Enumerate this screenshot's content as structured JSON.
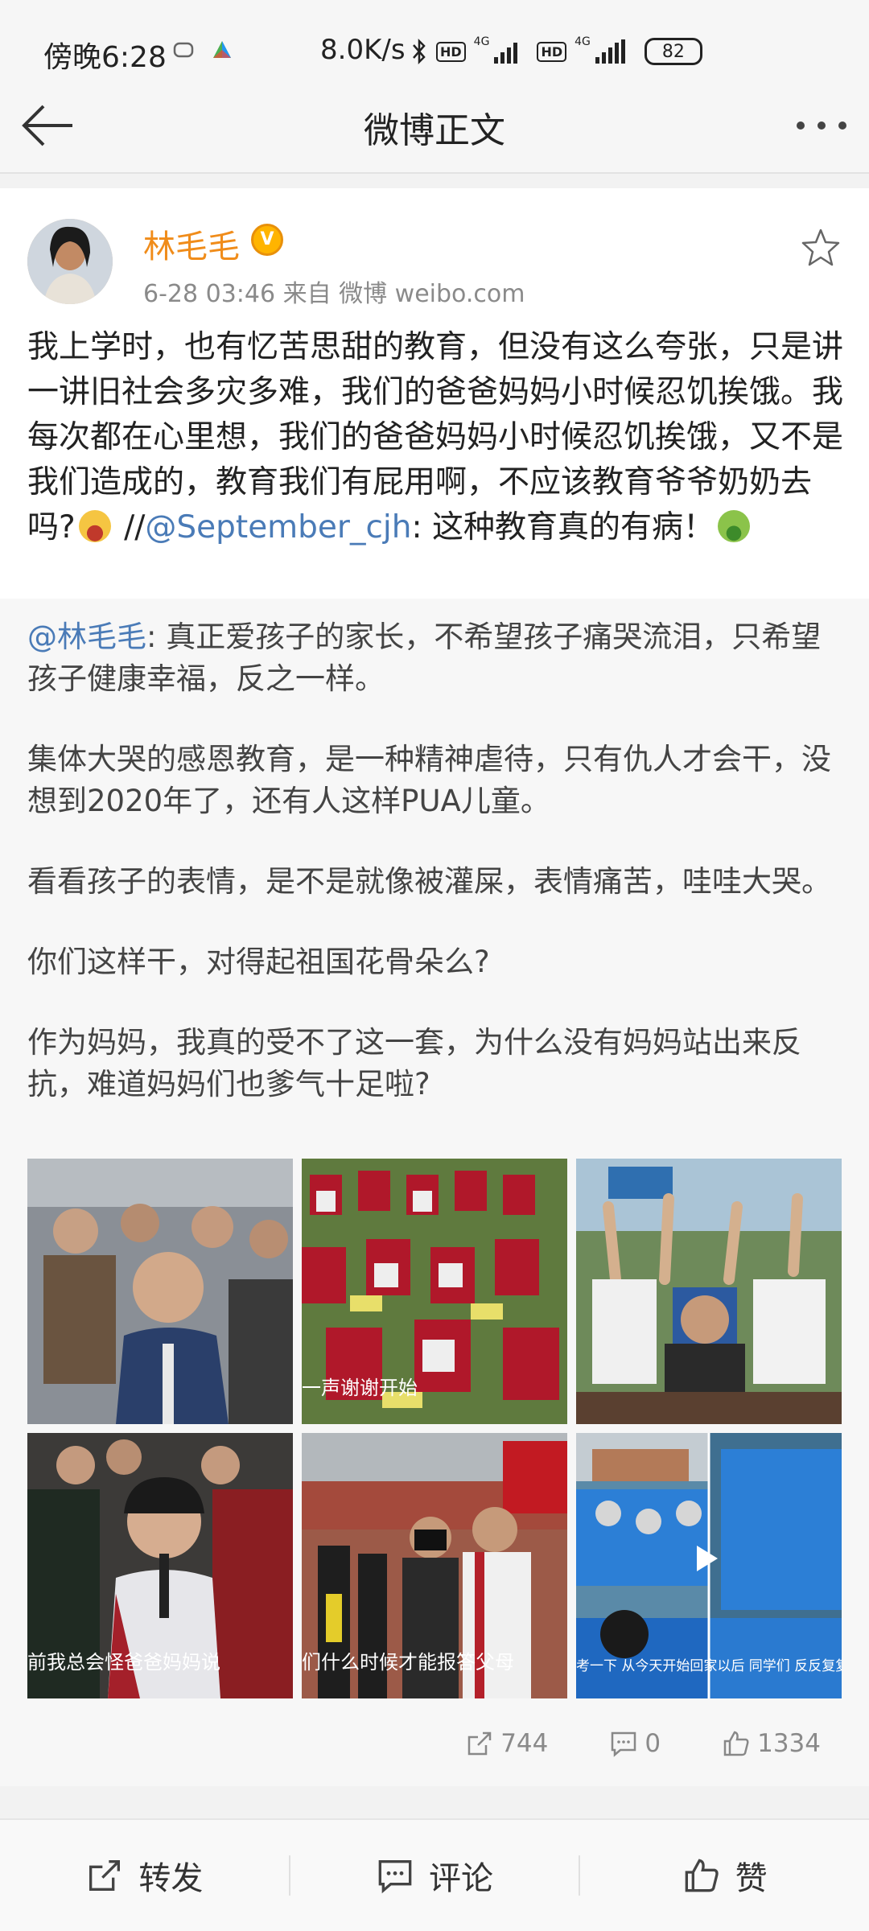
{
  "status_bar": {
    "time": "傍晚6:28",
    "speed": "8.0K/s",
    "hd1": "HD",
    "hd2": "HD",
    "net1": "4G",
    "net2": "4G",
    "battery": "82"
  },
  "header": {
    "title": "微博正文"
  },
  "post": {
    "author": "林毛毛",
    "meta": "6-28 03:46   来自 微博 weibo.com",
    "text_part1": "我上学时，也有忆苦思甜的教育，但没有这么夸张，只是讲一讲旧社会多灾多难，我们的爸爸妈妈小时候忍饥挨饿。我每次都在心里想，我们的爸爸妈妈小时候忍饥挨饿，又不是我们造成的，教育我们有屁用啊，不应该教育爷爷奶奶去吗?",
    "text_sep": " //",
    "mention": "@September_cjh",
    "text_part2": ": 这种教育真的有病！"
  },
  "repost": {
    "mention": "@林毛毛",
    "p1": ": 真正爱孩子的家长，不希望孩子痛哭流泪，只希望孩子健康幸福，反之一样。",
    "p2": "集体大哭的感恩教育，是一种精神虐待，只有仇人才会干，没想到2020年了，还有人这样PUA儿童。",
    "p3": "看看孩子的表情，是不是就像被灌屎，表情痛苦，哇哇大哭。",
    "p4": "你们这样干，对得起祖国花骨朵么?",
    "p5": "作为妈妈，我真的受不了这一套，为什么没有妈妈站出来反抗，难道妈妈们也爹气十足啦?",
    "images": [
      {
        "caption": ""
      },
      {
        "caption": "一声谢谢开始"
      },
      {
        "caption": ""
      },
      {
        "caption": "前我总会怪爸爸妈妈说"
      },
      {
        "caption": "们什么时候才能报答父母"
      },
      {
        "caption": "考一下 从今天开始回家以后     同学们 反反复复的去思考一"
      }
    ],
    "reposts": "744",
    "comments": "0",
    "likes": "1334"
  },
  "toolbar": {
    "repost": "转发",
    "comment": "评论",
    "like": "赞"
  },
  "colors": {
    "author": "#f08c1a",
    "link": "#4a7bb7",
    "repost_bg": "#f7f7f7"
  }
}
